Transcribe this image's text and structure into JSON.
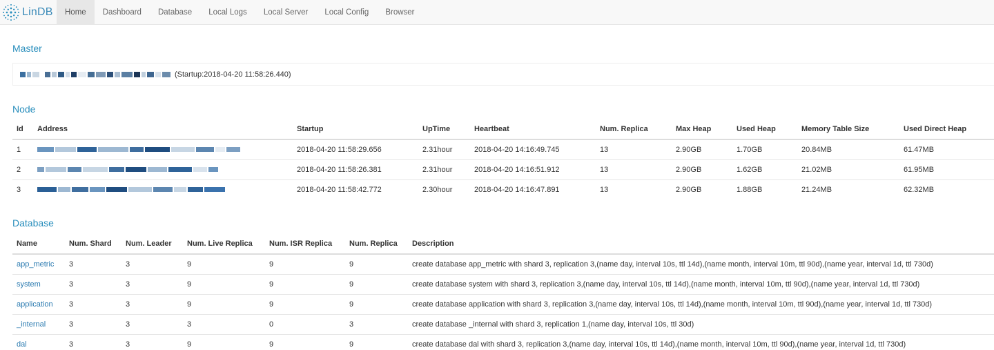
{
  "brand": {
    "name": "LinDB"
  },
  "nav": {
    "items": [
      {
        "label": "Home",
        "active": true
      },
      {
        "label": "Dashboard",
        "active": false
      },
      {
        "label": "Database",
        "active": false
      },
      {
        "label": "Local Logs",
        "active": false
      },
      {
        "label": "Local Server",
        "active": false
      },
      {
        "label": "Local Config",
        "active": false
      },
      {
        "label": "Browser",
        "active": false
      }
    ]
  },
  "master": {
    "title": "Master",
    "startup": "(Startup:2018-04-20 11:58:26.440)"
  },
  "node": {
    "title": "Node",
    "headers": [
      "Id",
      "Address",
      "Startup",
      "UpTime",
      "Heartbeat",
      "Num. Replica",
      "Max Heap",
      "Used Heap",
      "Memory Table Size",
      "Used Direct Heap"
    ],
    "rows": [
      [
        "1",
        "",
        "2018-04-20 11:58:29.656",
        "2.31hour",
        "2018-04-20 14:16:49.745",
        "13",
        "2.90GB",
        "1.70GB",
        "20.84MB",
        "61.47MB"
      ],
      [
        "2",
        "",
        "2018-04-20 11:58:26.381",
        "2.31hour",
        "2018-04-20 14:16:51.912",
        "13",
        "2.90GB",
        "1.62GB",
        "21.02MB",
        "61.95MB"
      ],
      [
        "3",
        "",
        "2018-04-20 11:58:42.772",
        "2.30hour",
        "2018-04-20 14:16:47.891",
        "13",
        "2.90GB",
        "1.88GB",
        "21.24MB",
        "62.32MB"
      ]
    ]
  },
  "database": {
    "title": "Database",
    "headers": [
      "Name",
      "Num. Shard",
      "Num. Leader",
      "Num. Live Replica",
      "Num. ISR Replica",
      "Num. Replica",
      "Description"
    ],
    "rows": [
      [
        "app_metric",
        "3",
        "3",
        "9",
        "9",
        "9",
        "create database app_metric with shard 3, replication 3,(name day, interval 10s, ttl 14d),(name month, interval 10m, ttl 90d),(name year, interval 1d, ttl 730d)"
      ],
      [
        "system",
        "3",
        "3",
        "9",
        "9",
        "9",
        "create database system with shard 3, replication 3,(name day, interval 10s, ttl 14d),(name month, interval 10m, ttl 90d),(name year, interval 1d, ttl 730d)"
      ],
      [
        "application",
        "3",
        "3",
        "9",
        "9",
        "9",
        "create database application with shard 3, replication 3,(name day, interval 10s, ttl 14d),(name month, interval 10m, ttl 90d),(name year, interval 1d, ttl 730d)"
      ],
      [
        "_internal",
        "3",
        "3",
        "3",
        "0",
        "3",
        "create database _internal with shard 3, replication 1,(name day, interval 10s, ttl 30d)"
      ],
      [
        "dal",
        "3",
        "3",
        "9",
        "9",
        "9",
        "create database dal with shard 3, replication 3,(name day, interval 10s, ttl 14d),(name month, interval 10m, ttl 90d),(name year, interval 1d, ttl 730d)"
      ]
    ]
  },
  "colors": {
    "accent": "#2a8fbd",
    "link": "#2a7ab0",
    "navbar": "#f8f8f8"
  }
}
